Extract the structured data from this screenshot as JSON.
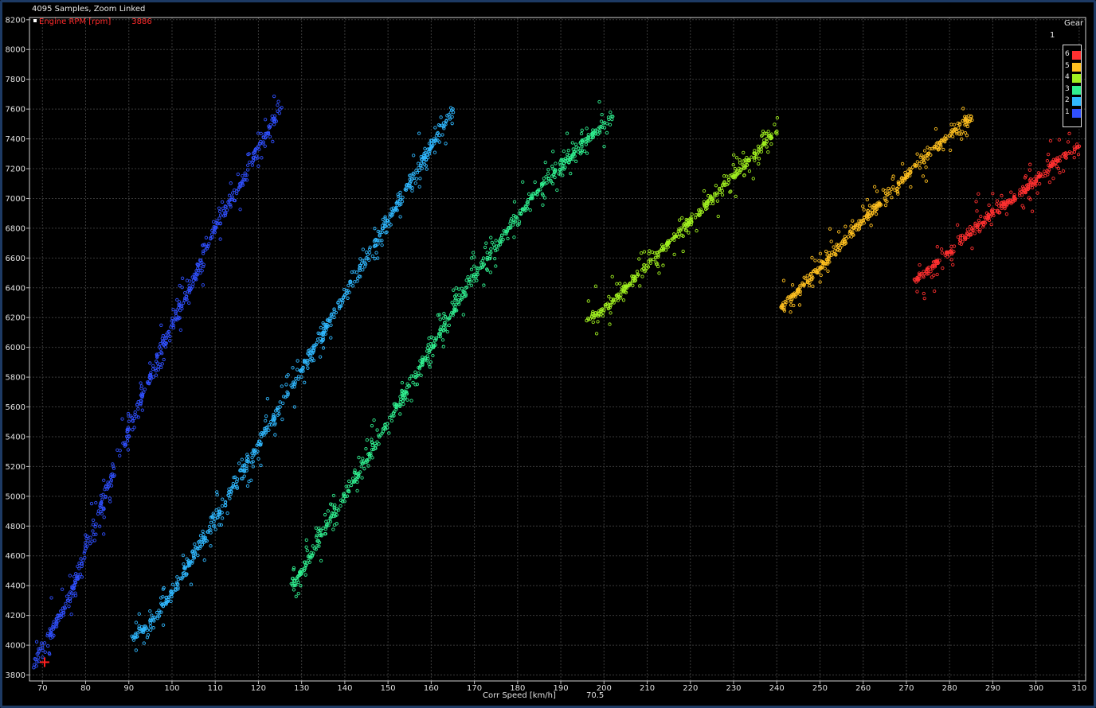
{
  "header": {
    "title": "4095 Samples, Zoom Linked",
    "channel_name": "Engine RPM [rpm]",
    "channel_value": "3886"
  },
  "cursor": {
    "x_value": "70.5",
    "x": 70.5,
    "y": 3886,
    "color": "#ff2020"
  },
  "legend": {
    "title": "Gear",
    "subtitle": "1",
    "items": [
      {
        "label": "6",
        "color": "#ff3030"
      },
      {
        "label": "5",
        "color": "#ffc020"
      },
      {
        "label": "4",
        "color": "#a0f020"
      },
      {
        "label": "3",
        "color": "#30f090"
      },
      {
        "label": "2",
        "color": "#30b8ff"
      },
      {
        "label": "1",
        "color": "#3050ff"
      }
    ]
  },
  "chart_data": {
    "type": "scatter",
    "title": "4095 Samples, Zoom Linked",
    "xlabel": "Corr Speed [km/h]",
    "ylabel": "Engine RPM [rpm]",
    "xlim": [
      67,
      311.5
    ],
    "ylim": [
      3760,
      8215
    ],
    "x_ticks": [
      70,
      80,
      90,
      100,
      110,
      120,
      130,
      140,
      150,
      160,
      170,
      180,
      190,
      200,
      210,
      220,
      230,
      240,
      250,
      260,
      270,
      280,
      290,
      300,
      310
    ],
    "y_ticks": [
      3800,
      4000,
      4200,
      4400,
      4600,
      4800,
      5000,
      5200,
      5400,
      5600,
      5800,
      6000,
      6200,
      6400,
      6600,
      6800,
      7000,
      7200,
      7400,
      7600,
      7800,
      8000,
      8200
    ],
    "grid": true,
    "legend_position": "top-right",
    "series": [
      {
        "name": "1",
        "color": "#3050ff",
        "x": [
          68,
          70,
          72,
          74,
          76,
          78,
          80,
          85,
          90,
          95,
          100,
          105,
          110,
          115,
          120,
          125
        ],
        "y": [
          3850,
          4000,
          4100,
          4200,
          4300,
          4450,
          4650,
          5050,
          5450,
          5800,
          6150,
          6450,
          6800,
          7050,
          7350,
          7600
        ]
      },
      {
        "name": "2",
        "color": "#30b8ff",
        "x": [
          91,
          95,
          100,
          105,
          110,
          115,
          120,
          125,
          130,
          135,
          140,
          145,
          150,
          155,
          160,
          165
        ],
        "y": [
          4050,
          4150,
          4350,
          4600,
          4850,
          5100,
          5350,
          5600,
          5850,
          6100,
          6350,
          6600,
          6850,
          7100,
          7350,
          7600
        ]
      },
      {
        "name": "3",
        "color": "#30f090",
        "x": [
          128,
          133,
          138,
          143,
          148,
          153,
          158,
          163,
          168,
          173,
          178,
          183,
          188,
          193,
          198,
          202
        ],
        "y": [
          4400,
          4650,
          4900,
          5150,
          5400,
          5650,
          5900,
          6150,
          6400,
          6600,
          6800,
          7000,
          7150,
          7300,
          7450,
          7550
        ]
      },
      {
        "name": "4",
        "color": "#a0f020",
        "x": [
          196,
          200,
          205,
          210,
          215,
          220,
          225,
          230,
          235,
          240
        ],
        "y": [
          6180,
          6250,
          6400,
          6550,
          6700,
          6850,
          7000,
          7150,
          7300,
          7450
        ]
      },
      {
        "name": "5",
        "color": "#ffc020",
        "x": [
          241,
          245,
          250,
          255,
          260,
          265,
          270,
          275,
          280,
          285
        ],
        "y": [
          6270,
          6380,
          6530,
          6700,
          6850,
          7000,
          7150,
          7300,
          7420,
          7550
        ]
      },
      {
        "name": "6",
        "color": "#ff3030",
        "x": [
          272,
          275,
          280,
          285,
          290,
          295,
          300,
          305,
          310
        ],
        "y": [
          6450,
          6520,
          6640,
          6780,
          6900,
          7000,
          7120,
          7250,
          7350
        ]
      }
    ]
  }
}
